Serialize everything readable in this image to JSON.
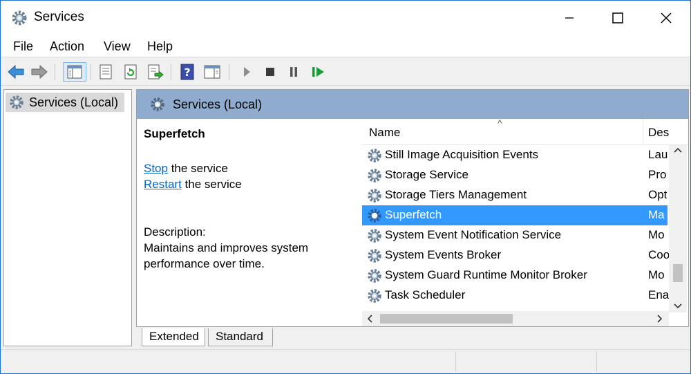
{
  "window": {
    "title": "Services"
  },
  "menu": [
    "File",
    "Action",
    "View",
    "Help"
  ],
  "toolbar": {
    "icons": [
      "back-arrow-icon",
      "forward-arrow-icon",
      "show-hide-console-tree-icon",
      "properties-icon",
      "refresh-icon",
      "export-list-icon",
      "help-icon",
      "show-action-pane-icon",
      "start-service-icon",
      "stop-service-icon",
      "pause-service-icon",
      "resume-service-icon"
    ]
  },
  "tree": {
    "root_label": "Services (Local)"
  },
  "content": {
    "header_label": "Services (Local)",
    "detail": {
      "service_name": "Superfetch",
      "stop_link": "Stop",
      "stop_suffix": " the service",
      "restart_link": "Restart",
      "restart_suffix": " the service",
      "description_label": "Description:",
      "description_text": "Maintains and improves system performance over time."
    },
    "list": {
      "col_name": "Name",
      "col_desc": "Des",
      "sort_glyph": "^",
      "rows": [
        {
          "name": "Still Image Acquisition Events",
          "desc": "Lau"
        },
        {
          "name": "Storage Service",
          "desc": "Pro"
        },
        {
          "name": "Storage Tiers Management",
          "desc": "Opt"
        },
        {
          "name": "Superfetch",
          "desc": "Ma",
          "selected": true
        },
        {
          "name": "System Event Notification Service",
          "desc": "Mo"
        },
        {
          "name": "System Events Broker",
          "desc": "Coo"
        },
        {
          "name": "System Guard Runtime Monitor Broker",
          "desc": "Mo"
        },
        {
          "name": "Task Scheduler",
          "desc": "Ena"
        }
      ]
    }
  },
  "tabs": [
    "Extended",
    "Standard"
  ],
  "colors": {
    "selection": "#3399ff",
    "header": "#8fabce",
    "link": "#0066cc"
  }
}
